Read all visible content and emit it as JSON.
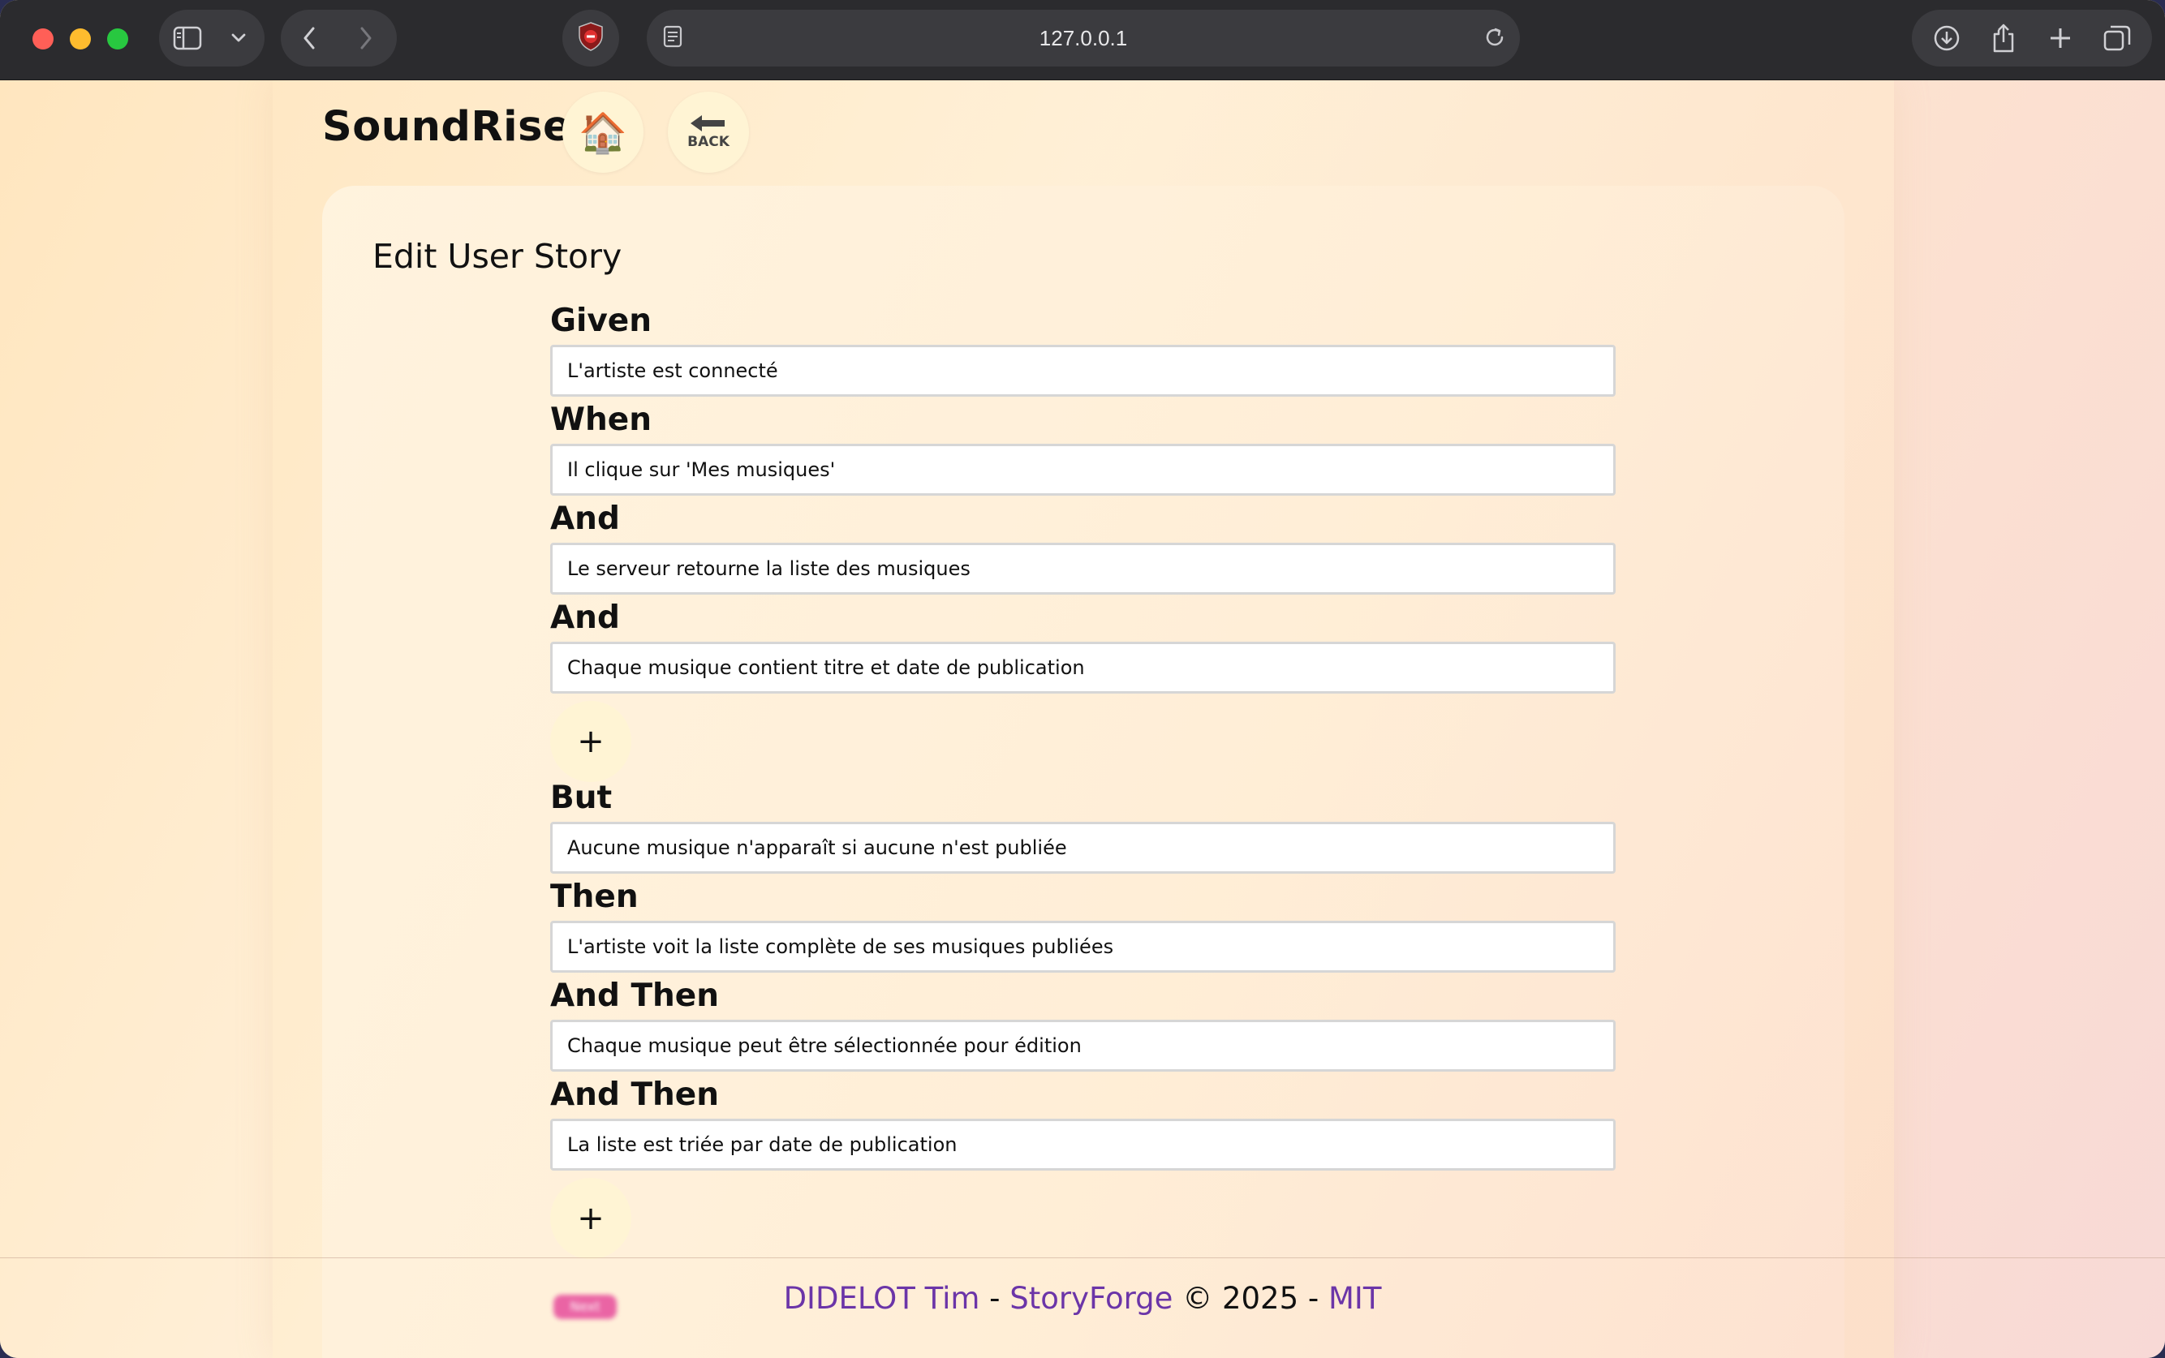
{
  "browser": {
    "url": "127.0.0.1",
    "icons": [
      "sidebar-icon",
      "chevron-down-icon",
      "back-arrow-icon",
      "forward-arrow-icon",
      "shield-icon",
      "site-settings-icon",
      "reload-icon",
      "download-icon",
      "share-icon",
      "new-tab-icon",
      "tab-overview-icon"
    ]
  },
  "header": {
    "logo": "SoundRise",
    "home_icon": "🏠",
    "back_label": "BACK"
  },
  "form": {
    "title": "Edit User Story",
    "add_label": "+",
    "fields": [
      {
        "label": "Given",
        "value": "L'artiste est connecté"
      },
      {
        "label": "When",
        "value": "Il clique sur 'Mes musiques'"
      },
      {
        "label": "And",
        "value": "Le serveur retourne la liste des musiques"
      },
      {
        "label": "And",
        "value": "Chaque musique contient titre et date de publication"
      },
      {
        "label": "But",
        "value": "Aucune musique n'apparaît si aucune n'est publiée"
      },
      {
        "label": "Then",
        "value": "L'artiste voit la liste complète de ses musiques publiées"
      },
      {
        "label": "And Then",
        "value": "Chaque musique peut être sélectionnée pour édition"
      },
      {
        "label": "And Then",
        "value": "La liste est triée par date de publication"
      }
    ],
    "next_label": "Next"
  },
  "footer": {
    "author": "DIDELOT Tim",
    "sep1": " - ",
    "project": "StoryForge",
    "copyright": " © 2025 - ",
    "license": "MIT"
  },
  "colors": {
    "accent_link": "#6b35a8",
    "next_button": "#e8559f",
    "button_bg": "#fff4d4"
  }
}
